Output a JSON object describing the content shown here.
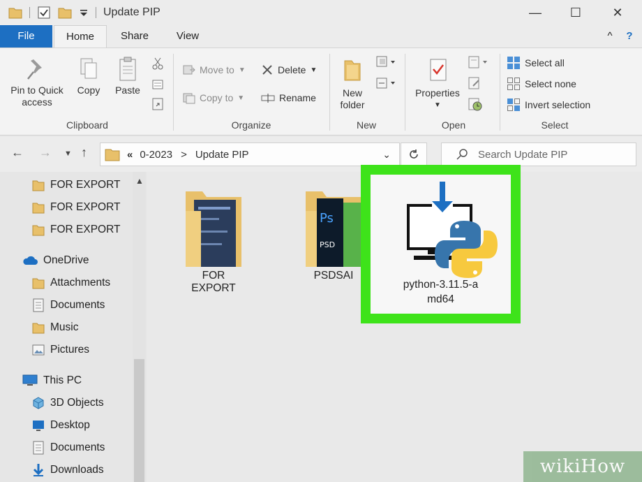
{
  "window": {
    "title": "Update PIP",
    "minimize": "—",
    "maximize": "☐",
    "close": "✕"
  },
  "tabs": {
    "file": "File",
    "home": "Home",
    "share": "Share",
    "view": "View",
    "collapse": "^",
    "help": "?"
  },
  "ribbon": {
    "clipboard": {
      "label": "Clipboard",
      "pin": "Pin to Quick access",
      "copy": "Copy",
      "paste": "Paste"
    },
    "organize": {
      "label": "Organize",
      "move_to": "Move to",
      "copy_to": "Copy to",
      "delete": "Delete",
      "rename": "Rename"
    },
    "new": {
      "label": "New",
      "new_folder": "New folder"
    },
    "open": {
      "label": "Open",
      "properties": "Properties"
    },
    "select": {
      "label": "Select",
      "select_all": "Select all",
      "select_none": "Select none",
      "invert": "Invert selection"
    }
  },
  "address": {
    "crumb_prefix": "«",
    "crumbs": [
      "0-2023",
      "Update PIP"
    ],
    "separator": ">",
    "search_placeholder": "Search Update PIP"
  },
  "nav_pane": {
    "items": [
      {
        "label": "FOR EXPORT",
        "icon": "folder-icon"
      },
      {
        "label": "FOR EXPORT",
        "icon": "folder-icon"
      },
      {
        "label": "FOR EXPORT",
        "icon": "folder-icon"
      },
      {
        "label": "OneDrive",
        "icon": "cloud-icon"
      },
      {
        "label": "Attachments",
        "icon": "folder-icon"
      },
      {
        "label": "Documents",
        "icon": "documents-icon"
      },
      {
        "label": "Music",
        "icon": "folder-icon"
      },
      {
        "label": "Pictures",
        "icon": "pictures-icon"
      },
      {
        "label": "This PC",
        "icon": "computer-icon"
      },
      {
        "label": "3D Objects",
        "icon": "cube-icon"
      },
      {
        "label": "Desktop",
        "icon": "desktop-icon"
      },
      {
        "label": "Documents",
        "icon": "documents-icon"
      },
      {
        "label": "Downloads",
        "icon": "download-icon"
      }
    ]
  },
  "files": [
    {
      "name": "FOR EXPORT",
      "icon": "folder-icon"
    },
    {
      "name": "PSDSAI",
      "icon": "folder-icon"
    },
    {
      "name_line1": "python-3.11.5-a",
      "name_line2": "md64",
      "icon": "python-installer-icon"
    }
  ],
  "watermark": "wikiHow",
  "colors": {
    "accent": "#1d6fc2",
    "highlight": "#3ee31a",
    "folder": "#e8c06a"
  }
}
